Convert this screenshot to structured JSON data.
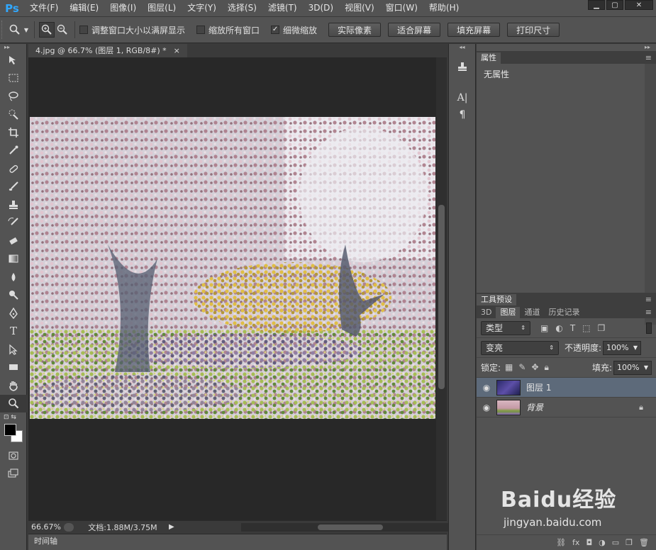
{
  "app": {
    "logo": "Ps"
  },
  "menu": [
    "文件(F)",
    "编辑(E)",
    "图像(I)",
    "图层(L)",
    "文字(Y)",
    "选择(S)",
    "滤镜(T)",
    "3D(D)",
    "视图(V)",
    "窗口(W)",
    "帮助(H)"
  ],
  "window_controls": {
    "minimize": "▁",
    "maximize": "▢",
    "close": "✕"
  },
  "options": {
    "check_resize_window": {
      "label": "调整窗口大小以满屏显示",
      "checked": false
    },
    "check_zoom_all": {
      "label": "缩放所有窗口",
      "checked": false
    },
    "check_scrubby_zoom": {
      "label": "细微缩放",
      "checked": true
    },
    "btn_actual_pixels": "实际像素",
    "btn_fit_screen": "适合屏幕",
    "btn_fill_screen": "填充屏幕",
    "btn_print_size": "打印尺寸"
  },
  "document": {
    "tab_title": "4.jpg @ 66.7% (图层 1, RGB/8#) *",
    "tab_close": "×",
    "zoom": "66.67%",
    "doc_info": "文档:1.88M/3.75M"
  },
  "timeline": {
    "label": "时间轴"
  },
  "properties": {
    "tab": "属性",
    "empty_text": "无属性"
  },
  "tool_presets": {
    "tab": "工具预设"
  },
  "layers": {
    "tabs": [
      "3D",
      "图层",
      "通道",
      "历史记录"
    ],
    "active_tab": "图层",
    "filter_kind": "类型",
    "blend_mode": "变亮",
    "opacity_label": "不透明度:",
    "opacity_value": "100%",
    "lock_label": "锁定:",
    "fill_label": "填充:",
    "fill_value": "100%",
    "items": [
      {
        "name": "图层 1",
        "selected": true
      },
      {
        "name": "背景",
        "selected": false
      }
    ]
  },
  "watermark": {
    "logo": "Baidu经验",
    "url": "jingyan.baidu.com"
  }
}
